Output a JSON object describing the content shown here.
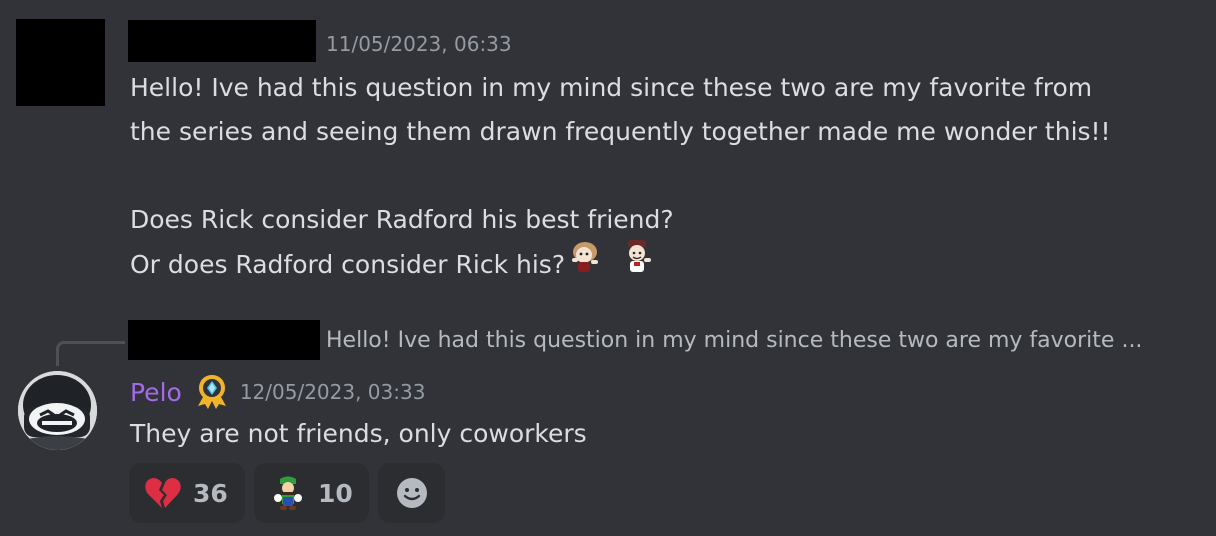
{
  "message1": {
    "author_redacted": true,
    "timestamp": "11/05/2023, 06:33",
    "lines": [
      "Hello! Ive had this question in my mind since these two are my favorite from",
      "the series and seeing them drawn frequently together made me wonder this!!",
      "",
      "Does Rick consider Radford his best friend?",
      "Or does Radford consider Rick his?"
    ],
    "emojis": [
      "radford-sticker-emoji",
      "rick-sticker-emoji"
    ]
  },
  "reply": {
    "preview": "Hello! Ive had this question in my mind since these two are my favorite ..."
  },
  "message2": {
    "username": "Pelo",
    "badge_icon": "gold-badge-icon",
    "timestamp": "12/05/2023, 03:33",
    "text": "They are not friends, only coworkers",
    "username_color": "#a46be9"
  },
  "reactions": [
    {
      "icon": "broken-heart-icon",
      "count": "36"
    },
    {
      "icon": "luigi-emoji-icon",
      "count": "10"
    },
    {
      "icon": "add-reaction-icon"
    }
  ]
}
